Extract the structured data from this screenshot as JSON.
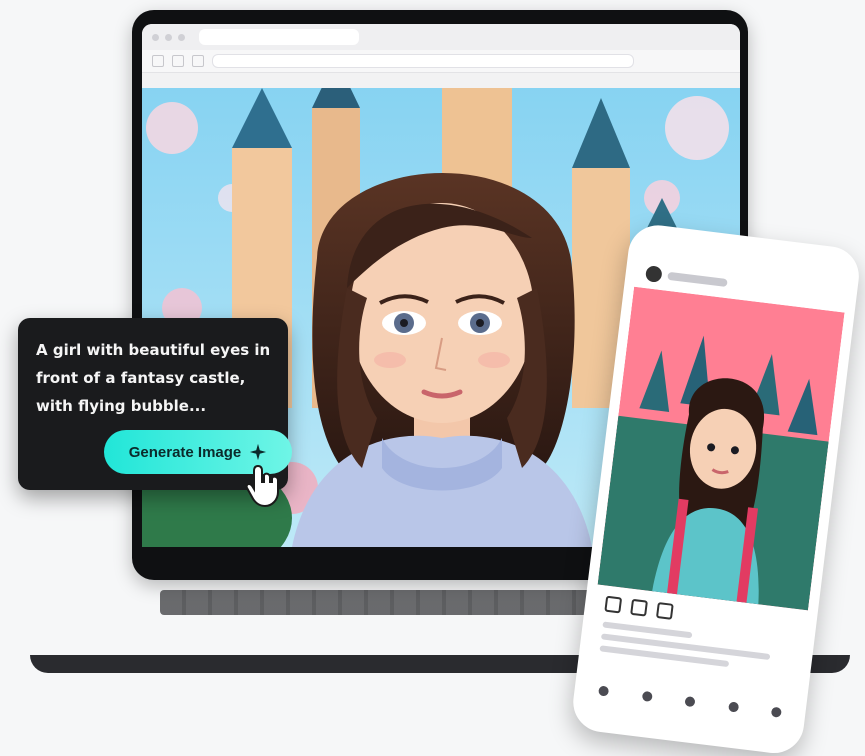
{
  "prompt_card": {
    "prompt_text": "A girl with beautiful eyes in front of a fantasy castle, with flying bubble...",
    "generate_button_label": "Generate Image"
  },
  "colors": {
    "generate_button": "#21e6d8",
    "card_background": "#1a1b1d",
    "sky": "#7fd0ef",
    "castle": "#f0c79b"
  },
  "icons": {
    "generate_button_icon": "sparkle-icon",
    "pointer": "hand-cursor-icon"
  }
}
